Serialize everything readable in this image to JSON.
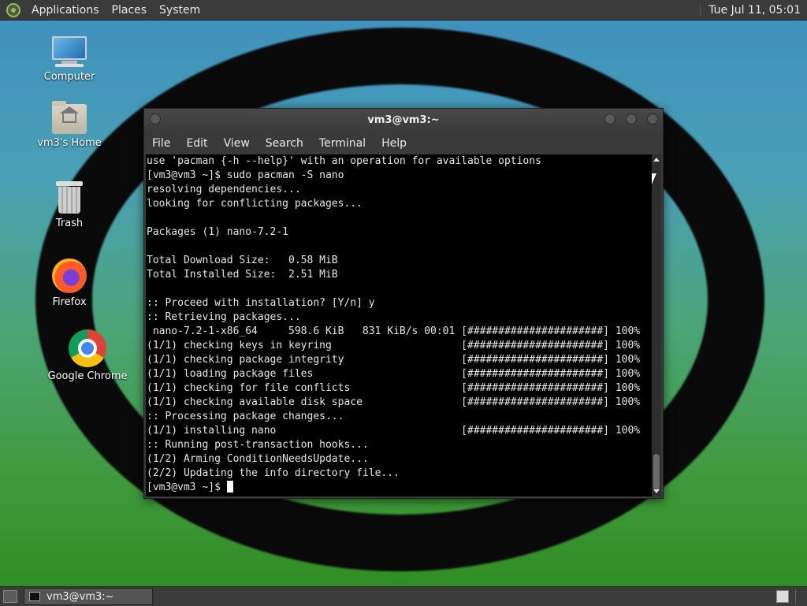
{
  "top_panel": {
    "menus": [
      "Applications",
      "Places",
      "System"
    ],
    "clock": "Tue Jul 11, 05:01"
  },
  "desktop_icons": [
    {
      "label": "Computer",
      "icon": "computer-icon"
    },
    {
      "label": "vm3's Home",
      "icon": "home-folder-icon"
    },
    {
      "label": "Trash",
      "icon": "trash-icon"
    },
    {
      "label": "Firefox",
      "icon": "firefox-icon"
    },
    {
      "label": "Google Chrome",
      "icon": "chrome-icon"
    }
  ],
  "terminal": {
    "title": "vm3@vm3:~",
    "menus": [
      "File",
      "Edit",
      "View",
      "Search",
      "Terminal",
      "Help"
    ],
    "lines": [
      "use 'pacman {-h --help}' with an operation for available options",
      "[vm3@vm3 ~]$ sudo pacman -S nano",
      "resolving dependencies...",
      "looking for conflicting packages...",
      "",
      "Packages (1) nano-7.2-1",
      "",
      "Total Download Size:   0.58 MiB",
      "Total Installed Size:  2.51 MiB",
      "",
      ":: Proceed with installation? [Y/n] y",
      ":: Retrieving packages...",
      " nano-7.2-1-x86_64     598.6 KiB   831 KiB/s 00:01 [######################] 100%",
      "(1/1) checking keys in keyring                     [######################] 100%",
      "(1/1) checking package integrity                   [######################] 100%",
      "(1/1) loading package files                        [######################] 100%",
      "(1/1) checking for file conflicts                  [######################] 100%",
      "(1/1) checking available disk space                [######################] 100%",
      ":: Processing package changes...",
      "(1/1) installing nano                              [######################] 100%",
      ":: Running post-transaction hooks...",
      "(1/2) Arming ConditionNeedsUpdate...",
      "(2/2) Updating the info directory file..."
    ],
    "prompt": "[vm3@vm3 ~]$ "
  },
  "taskbar": {
    "task_label": "vm3@vm3:~"
  }
}
